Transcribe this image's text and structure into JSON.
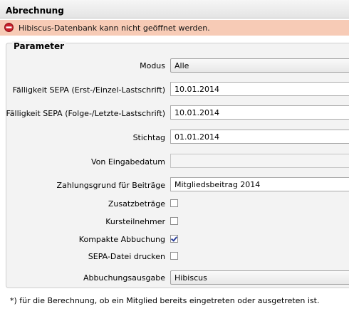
{
  "window": {
    "title": "Abrechnung"
  },
  "error": {
    "message": "Hibiscus-Datenbank kann nicht geöffnet werden."
  },
  "parameter": {
    "title": "Parameter",
    "modus": {
      "label": "Modus",
      "value": "Alle"
    },
    "faelligkeit_erst": {
      "label": "Fälligkeit SEPA (Erst-/Einzel-Lastschrift)",
      "value": "10.01.2014"
    },
    "faelligkeit_folge": {
      "label": "Fälligkeit SEPA (Folge-/Letzte-Lastschrift)",
      "value": "10.01.2014"
    },
    "stichtag": {
      "label": "Stichtag",
      "value": "01.01.2014"
    },
    "von_eingabedatum": {
      "label": "Von Eingabedatum",
      "value": ""
    },
    "zahlungsgrund": {
      "label": "Zahlungsgrund für Beiträge",
      "value": "Mitgliedsbeitrag 2014"
    },
    "zusatzbetraege": {
      "label": "Zusatzbeträge",
      "checked": false
    },
    "kursteilnehmer": {
      "label": "Kursteilnehmer",
      "checked": false
    },
    "kompakte_abbuchung": {
      "label": "Kompakte Abbuchung",
      "checked": true
    },
    "sepa_datei_drucken": {
      "label": "SEPA-Datei drucken",
      "checked": false
    },
    "abbuchungsausgabe": {
      "label": "Abbuchungsausgabe",
      "value": "Hibiscus"
    }
  },
  "footnote": "*) für die Berechnung, ob ein Mitglied bereits eingetreten oder ausgetreten ist."
}
